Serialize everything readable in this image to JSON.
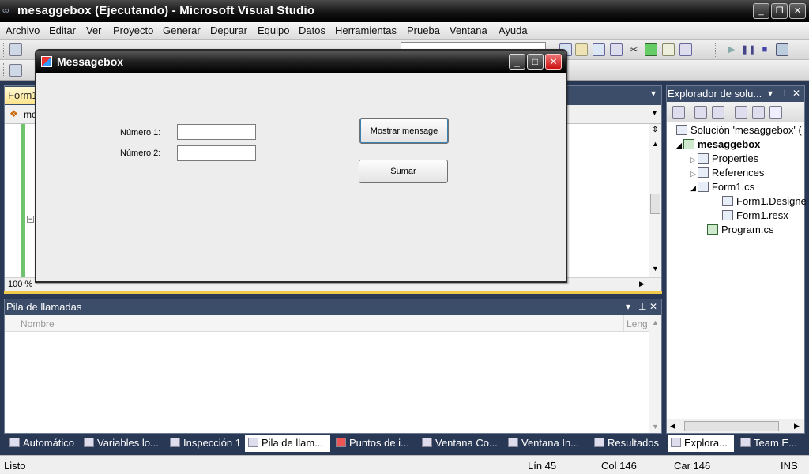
{
  "window": {
    "title": "mesaggebox (Ejecutando) - Microsoft Visual Studio",
    "icon": "vs-infinity-icon"
  },
  "menu": [
    "Archivo",
    "Editar",
    "Ver",
    "Proyecto",
    "Generar",
    "Depurar",
    "Equipo",
    "Datos",
    "Herramientas",
    "Prueba",
    "Ventana",
    "Ayuda"
  ],
  "editor": {
    "tab_label": "Form1",
    "nav_label": "me",
    "zoom": "100 %"
  },
  "solution_explorer": {
    "title": "Explorador de solu...",
    "items": [
      {
        "label": "Solución 'mesaggebox'  (",
        "icon": "solution-icon"
      },
      {
        "label": "mesaggebox",
        "icon": "csharp-project-icon"
      },
      {
        "label": "Properties",
        "icon": "properties-icon"
      },
      {
        "label": "References",
        "icon": "references-icon"
      },
      {
        "label": "Form1.cs",
        "icon": "form-icon"
      },
      {
        "label": "Form1.Designe",
        "icon": "cs-file-icon"
      },
      {
        "label": "Form1.resx",
        "icon": "resx-icon"
      },
      {
        "label": "Program.cs",
        "icon": "cs-file-icon"
      }
    ]
  },
  "call_stack": {
    "title": "Pila de llamadas",
    "columns": [
      "Nombre",
      "Leng"
    ]
  },
  "bottom_tabs": [
    "Automático",
    "Variables lo...",
    "Inspección 1",
    "Pila de llam...",
    "Puntos de i...",
    "Ventana Co...",
    "Ventana In...",
    "Resultados",
    "Explora...",
    "Team E..."
  ],
  "status": {
    "text": "Listo",
    "line": "Lín 45",
    "col": "Col 146",
    "car": "Car 146",
    "mode": "INS"
  },
  "app": {
    "title": "Messagebox",
    "label1": "Número 1:",
    "label2": "Número 2:",
    "input1_value": "",
    "input2_value": "",
    "button_show": "Mostrar mensage",
    "button_sum": "Sumar"
  },
  "colors": {
    "vs_frame": "#293955",
    "tab_active": "#ffe48c"
  }
}
